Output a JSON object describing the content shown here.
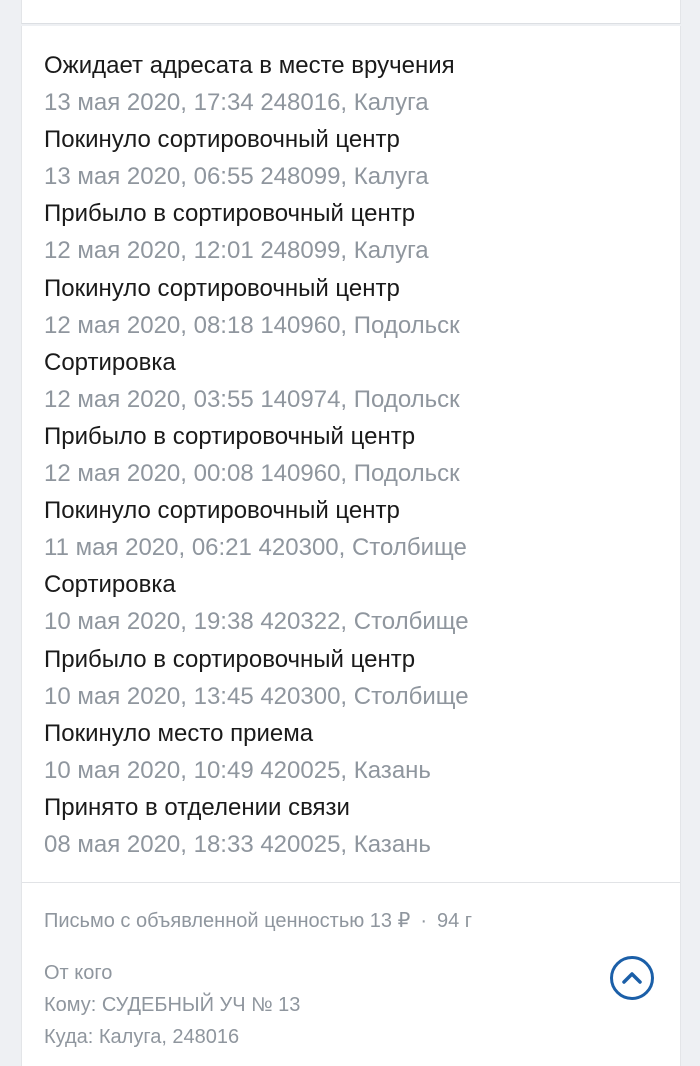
{
  "tracking": {
    "events": [
      {
        "status": "Ожидает адресата в месте вручения",
        "details": "13 мая 2020, 17:34 248016, Калуга"
      },
      {
        "status": "Покинуло сортировочный центр",
        "details": "13 мая 2020, 06:55 248099, Калуга"
      },
      {
        "status": "Прибыло в сортировочный центр",
        "details": "12 мая 2020, 12:01 248099, Калуга"
      },
      {
        "status": "Покинуло сортировочный центр",
        "details": "12 мая 2020, 08:18 140960, Подольск"
      },
      {
        "status": "Сортировка",
        "details": "12 мая 2020, 03:55 140974, Подольск"
      },
      {
        "status": "Прибыло в сортировочный центр",
        "details": "12 мая 2020, 00:08 140960, Подольск"
      },
      {
        "status": "Покинуло сортировочный центр",
        "details": "11 мая 2020, 06:21 420300, Столбище"
      },
      {
        "status": "Сортировка",
        "details": "10 мая 2020, 19:38 420322, Столбище"
      },
      {
        "status": "Прибыло в сортировочный центр",
        "details": "10 мая 2020, 13:45 420300, Столбище"
      },
      {
        "status": "Покинуло место приема",
        "details": "10 мая 2020, 10:49 420025, Казань"
      },
      {
        "status": "Принято в отделении связи",
        "details": "08 мая 2020, 18:33 420025, Казань"
      }
    ]
  },
  "shipment": {
    "type": "Письмо с объявленной ценностью 13 ₽",
    "separator": "·",
    "weight": "94 г",
    "from_label": "От кого",
    "to": "Кому: СУДЕБНЫЙ УЧ № 13",
    "destination": "Куда: Калуга, 248016"
  },
  "icons": {
    "scroll_up": "chevron-up-circle-icon"
  },
  "colors": {
    "accent": "#1b5fa8",
    "text_primary": "#1a1a1a",
    "text_secondary": "#8f969e",
    "background": "#eef0f3"
  }
}
